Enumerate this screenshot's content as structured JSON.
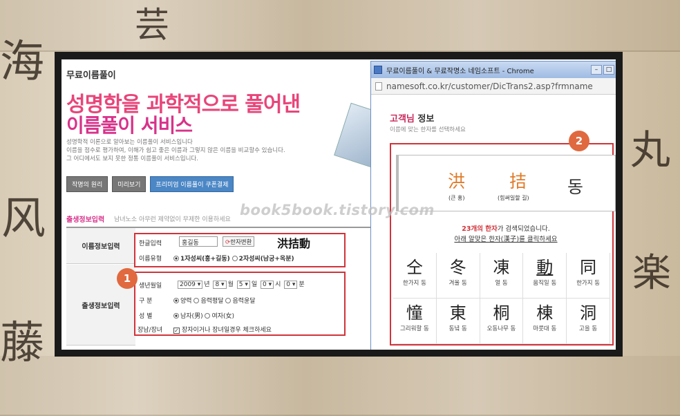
{
  "left_page": {
    "page_title": "무료이름풀이",
    "headline_line1": "성명학을 과학적으로 풀어낸",
    "headline_line2": "이름풀이 서비스",
    "desc_line1": "성명학적 이론으로 알아보는 이름풀이 서비스입니다",
    "desc_line2": "이름을 점수로 평가하여, 이해가 쉽고 좋은 이름과 그렇지 않은 이름을 비교할수 있습니다.",
    "desc_line3": "그 어디에서도 보지 못한 정통 이름풀이 서비스입니다.",
    "buttons": [
      "작명의 원리",
      "미리보기",
      "프리미엄 이름풀이 쿠폰결제"
    ],
    "section_title": "출생정보입력",
    "section_sub": "남녀노소 아무런 제약없이 무제한 이용하세요",
    "form": {
      "row1_label": "이름정보입력",
      "row2_label": "출생정보입력",
      "hangul_label": "한글입력",
      "hangul_value": "홍길동",
      "hanja_button": "한자변환",
      "hanja_result": "洪拮動",
      "name_type_label": "이름유형",
      "name_type_opt1": "1자성씨(홍+길동)",
      "name_type_opt2": "2자성씨(남궁+옥분)",
      "birth_label": "생년월일",
      "year": "2009",
      "year_unit": "년",
      "month": "8",
      "month_unit": "월",
      "day": "5",
      "day_unit": "일",
      "hour": "0",
      "hour_unit": "시",
      "minute": "0",
      "minute_unit": "분",
      "calendar_label": "구  분",
      "cal_opt1": "양력",
      "cal_opt2": "음력평달",
      "cal_opt3": "음력윤달",
      "gender_label": "성  별",
      "gender_opt1": "남자(男)",
      "gender_opt2": "여자(女)",
      "eldest_label": "장남/장녀",
      "eldest_text": "장자이거나 장녀일경우 체크하세요"
    },
    "badge": "1"
  },
  "watermark": "book5book.tistory.com",
  "chrome_window": {
    "title": "무료이름풀이 & 무료작명소 네임소프트 - Chrome",
    "url": "namesoft.co.kr/customer/DicTrans2.asp?frmname",
    "heading_accent": "고객님",
    "heading_rest": " 정보",
    "subheading": "이름에 맞는 한자를 선택하세요",
    "badge": "2",
    "name_chars": [
      {
        "char": "洪",
        "meaning": "(큰 홍)"
      },
      {
        "char": "拮",
        "meaning": "(힘써일할 길)"
      },
      {
        "char": "동",
        "meaning": ""
      }
    ],
    "found_count": "23개의 한자",
    "found_rest": "가 검색되었습니다.",
    "click_text": "아래 알맞은 한자(漢子)를 클릭하세요",
    "hanja_list": [
      {
        "char": "仝",
        "meaning": "한가지 동"
      },
      {
        "char": "冬",
        "meaning": "겨울 동"
      },
      {
        "char": "凍",
        "meaning": "얼 동"
      },
      {
        "char": "動",
        "meaning": "움직일 동"
      },
      {
        "char": "同",
        "meaning": "한가지 동"
      },
      {
        "char": "憧",
        "meaning": "그리워할 동"
      },
      {
        "char": "東",
        "meaning": "동녘 동"
      },
      {
        "char": "桐",
        "meaning": "오동나무 동"
      },
      {
        "char": "棟",
        "meaning": "마룻대 동"
      },
      {
        "char": "洞",
        "meaning": "고을 동"
      }
    ]
  },
  "background_calligraphy": [
    "海",
    "芸",
    "风",
    "藤",
    "丸",
    "楽"
  ]
}
